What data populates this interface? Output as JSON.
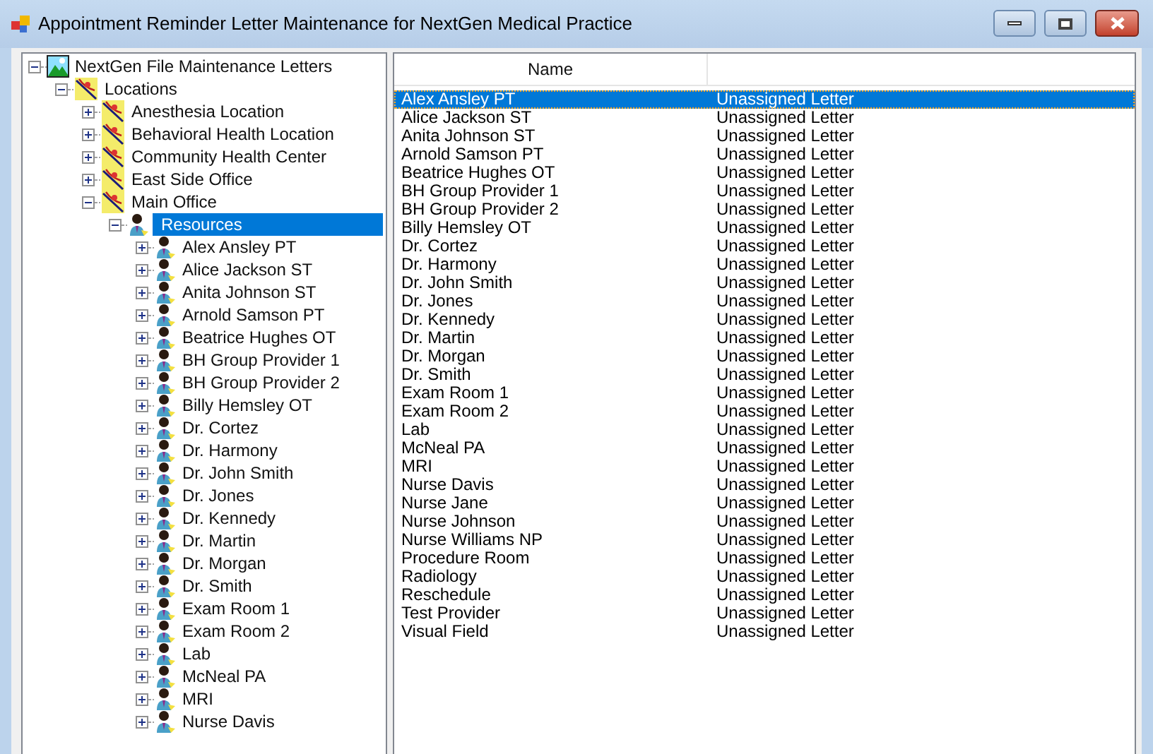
{
  "window": {
    "title": "Appointment Reminder Letter Maintenance for NextGen Medical Practice"
  },
  "tree": [
    {
      "label": "NextGen File Maintenance Letters",
      "kind": "root",
      "expanded": true,
      "selected": false,
      "children": [
        {
          "label": "Locations",
          "kind": "location",
          "expanded": true,
          "selected": false,
          "children": [
            {
              "label": "Anesthesia Location",
              "kind": "location",
              "expanded": false,
              "selected": false
            },
            {
              "label": "Behavioral Health Location",
              "kind": "location",
              "expanded": false,
              "selected": false
            },
            {
              "label": "Community Health Center",
              "kind": "location",
              "expanded": false,
              "selected": false
            },
            {
              "label": "East Side Office",
              "kind": "location",
              "expanded": false,
              "selected": false
            },
            {
              "label": "Main Office",
              "kind": "location",
              "expanded": true,
              "selected": false,
              "children": [
                {
                  "label": "Resources",
                  "kind": "resource",
                  "expanded": true,
                  "selected": true,
                  "children": [
                    {
                      "label": "Alex Ansley PT",
                      "kind": "resource",
                      "expanded": false,
                      "selected": false
                    },
                    {
                      "label": "Alice Jackson ST",
                      "kind": "resource",
                      "expanded": false,
                      "selected": false
                    },
                    {
                      "label": "Anita Johnson ST",
                      "kind": "resource",
                      "expanded": false,
                      "selected": false
                    },
                    {
                      "label": "Arnold Samson PT",
                      "kind": "resource",
                      "expanded": false,
                      "selected": false
                    },
                    {
                      "label": "Beatrice Hughes OT",
                      "kind": "resource",
                      "expanded": false,
                      "selected": false
                    },
                    {
                      "label": "BH Group Provider 1",
                      "kind": "resource",
                      "expanded": false,
                      "selected": false
                    },
                    {
                      "label": "BH Group Provider 2",
                      "kind": "resource",
                      "expanded": false,
                      "selected": false
                    },
                    {
                      "label": "Billy Hemsley OT",
                      "kind": "resource",
                      "expanded": false,
                      "selected": false
                    },
                    {
                      "label": "Dr. Cortez",
                      "kind": "resource",
                      "expanded": false,
                      "selected": false
                    },
                    {
                      "label": "Dr. Harmony",
                      "kind": "resource",
                      "expanded": false,
                      "selected": false
                    },
                    {
                      "label": "Dr. John Smith",
                      "kind": "resource",
                      "expanded": false,
                      "selected": false
                    },
                    {
                      "label": "Dr. Jones",
                      "kind": "resource",
                      "expanded": false,
                      "selected": false
                    },
                    {
                      "label": "Dr. Kennedy",
                      "kind": "resource",
                      "expanded": false,
                      "selected": false
                    },
                    {
                      "label": "Dr. Martin",
                      "kind": "resource",
                      "expanded": false,
                      "selected": false
                    },
                    {
                      "label": "Dr. Morgan",
                      "kind": "resource",
                      "expanded": false,
                      "selected": false
                    },
                    {
                      "label": "Dr. Smith",
                      "kind": "resource",
                      "expanded": false,
                      "selected": false
                    },
                    {
                      "label": "Exam Room 1",
                      "kind": "resource",
                      "expanded": false,
                      "selected": false
                    },
                    {
                      "label": "Exam Room 2",
                      "kind": "resource",
                      "expanded": false,
                      "selected": false
                    },
                    {
                      "label": "Lab",
                      "kind": "resource",
                      "expanded": false,
                      "selected": false
                    },
                    {
                      "label": "McNeal PA",
                      "kind": "resource",
                      "expanded": false,
                      "selected": false
                    },
                    {
                      "label": "MRI",
                      "kind": "resource",
                      "expanded": false,
                      "selected": false
                    },
                    {
                      "label": "Nurse Davis",
                      "kind": "resource",
                      "expanded": false,
                      "selected": false
                    }
                  ]
                }
              ]
            }
          ]
        }
      ]
    }
  ],
  "list": {
    "columns": [
      "Name"
    ],
    "rows": [
      {
        "name": "Alex Ansley PT",
        "letter": "Unassigned Letter",
        "selected": true
      },
      {
        "name": "Alice Jackson ST",
        "letter": "Unassigned Letter",
        "selected": false
      },
      {
        "name": "Anita Johnson ST",
        "letter": "Unassigned Letter",
        "selected": false
      },
      {
        "name": "Arnold Samson PT",
        "letter": "Unassigned Letter",
        "selected": false
      },
      {
        "name": "Beatrice Hughes OT",
        "letter": "Unassigned Letter",
        "selected": false
      },
      {
        "name": "BH Group Provider 1",
        "letter": "Unassigned Letter",
        "selected": false
      },
      {
        "name": "BH Group Provider 2",
        "letter": "Unassigned Letter",
        "selected": false
      },
      {
        "name": "Billy Hemsley OT",
        "letter": "Unassigned Letter",
        "selected": false
      },
      {
        "name": "Dr. Cortez",
        "letter": "Unassigned Letter",
        "selected": false
      },
      {
        "name": "Dr. Harmony",
        "letter": "Unassigned Letter",
        "selected": false
      },
      {
        "name": "Dr. John Smith",
        "letter": "Unassigned Letter",
        "selected": false
      },
      {
        "name": "Dr. Jones",
        "letter": "Unassigned Letter",
        "selected": false
      },
      {
        "name": "Dr. Kennedy",
        "letter": "Unassigned Letter",
        "selected": false
      },
      {
        "name": "Dr. Martin",
        "letter": "Unassigned Letter",
        "selected": false
      },
      {
        "name": "Dr. Morgan",
        "letter": "Unassigned Letter",
        "selected": false
      },
      {
        "name": "Dr. Smith",
        "letter": "Unassigned Letter",
        "selected": false
      },
      {
        "name": "Exam Room 1",
        "letter": "Unassigned Letter",
        "selected": false
      },
      {
        "name": "Exam Room 2",
        "letter": "Unassigned Letter",
        "selected": false
      },
      {
        "name": "Lab",
        "letter": "Unassigned Letter",
        "selected": false
      },
      {
        "name": "McNeal PA",
        "letter": "Unassigned Letter",
        "selected": false
      },
      {
        "name": "MRI",
        "letter": "Unassigned Letter",
        "selected": false
      },
      {
        "name": "Nurse Davis",
        "letter": "Unassigned Letter",
        "selected": false
      },
      {
        "name": "Nurse Jane",
        "letter": "Unassigned Letter",
        "selected": false
      },
      {
        "name": "Nurse Johnson",
        "letter": "Unassigned Letter",
        "selected": false
      },
      {
        "name": "Nurse Williams NP",
        "letter": "Unassigned Letter",
        "selected": false
      },
      {
        "name": "Procedure Room",
        "letter": "Unassigned Letter",
        "selected": false
      },
      {
        "name": "Radiology",
        "letter": "Unassigned Letter",
        "selected": false
      },
      {
        "name": "Reschedule",
        "letter": "Unassigned Letter",
        "selected": false
      },
      {
        "name": "Test Provider",
        "letter": "Unassigned Letter",
        "selected": false
      },
      {
        "name": "Visual Field",
        "letter": "Unassigned Letter",
        "selected": false
      }
    ]
  }
}
